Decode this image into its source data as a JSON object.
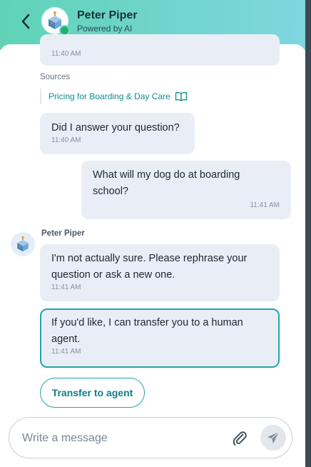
{
  "header": {
    "name": "Peter Piper",
    "subtitle": "Powered by AI"
  },
  "messages": {
    "top_partial_time": "11:40 AM",
    "sources_label": "Sources",
    "source_link": "Pricing for Boarding & Day Care",
    "q1": {
      "text": "Did I answer your question?",
      "time": "11:40 AM"
    },
    "user1": {
      "text": "What will my dog do at boarding school?",
      "time": "11:41 AM"
    },
    "bot_name": "Peter Piper",
    "bot1": {
      "text": "I'm not actually sure. Please rephrase your question or ask a new one.",
      "time": "11:41 AM"
    },
    "bot2": {
      "text": "If you'd like, I can transfer you to a human agent.",
      "time": "11:41 AM"
    }
  },
  "actions": {
    "transfer_label": "Transfer to agent"
  },
  "composer": {
    "placeholder": "Write a message"
  },
  "colors": {
    "header_start": "#5fd3b6",
    "header_end": "#7fd6df",
    "accent": "#23a6a4",
    "bubble": "#e9eef6"
  }
}
